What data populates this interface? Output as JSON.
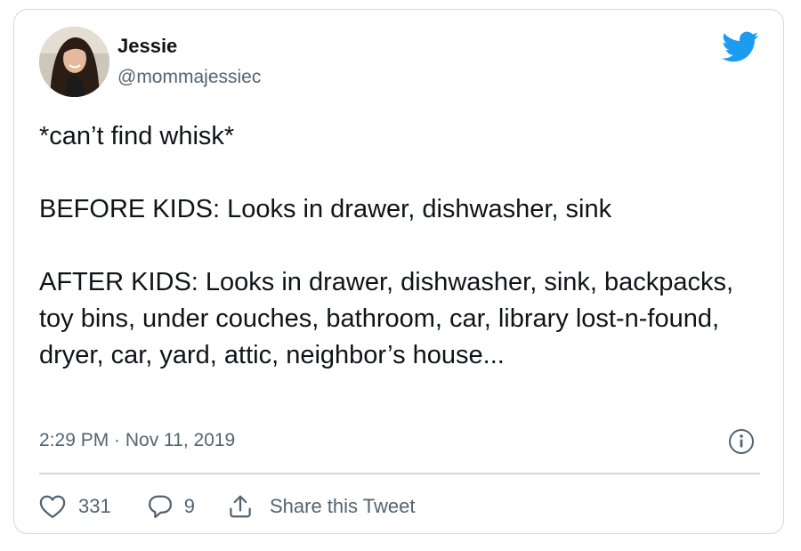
{
  "author": {
    "name": "Jessie",
    "handle": "@mommajessiec",
    "avatar_icon": "profile-photo"
  },
  "tweet": {
    "line1": "*can’t find whisk*",
    "line2": "BEFORE KIDS: Looks in drawer, dishwasher, sink",
    "line3": "AFTER KIDS: Looks in drawer, dishwasher, sink, backpacks, toy bins, under couches, bathroom, car, library lost-n-found, dryer, car, yard, attic, neighbor’s house..."
  },
  "meta": {
    "timestamp": "2:29 PM · Nov 11, 2019"
  },
  "actions": {
    "like_count": "331",
    "reply_count": "9",
    "share_label": "Share this Tweet"
  },
  "colors": {
    "text": "#0f1419",
    "secondary": "#536471",
    "brand": "#1d9bf0",
    "border": "#cfd9de"
  },
  "icons": [
    "twitter-bird-icon",
    "info-icon",
    "heart-icon",
    "reply-bubble-icon",
    "share-icon"
  ]
}
